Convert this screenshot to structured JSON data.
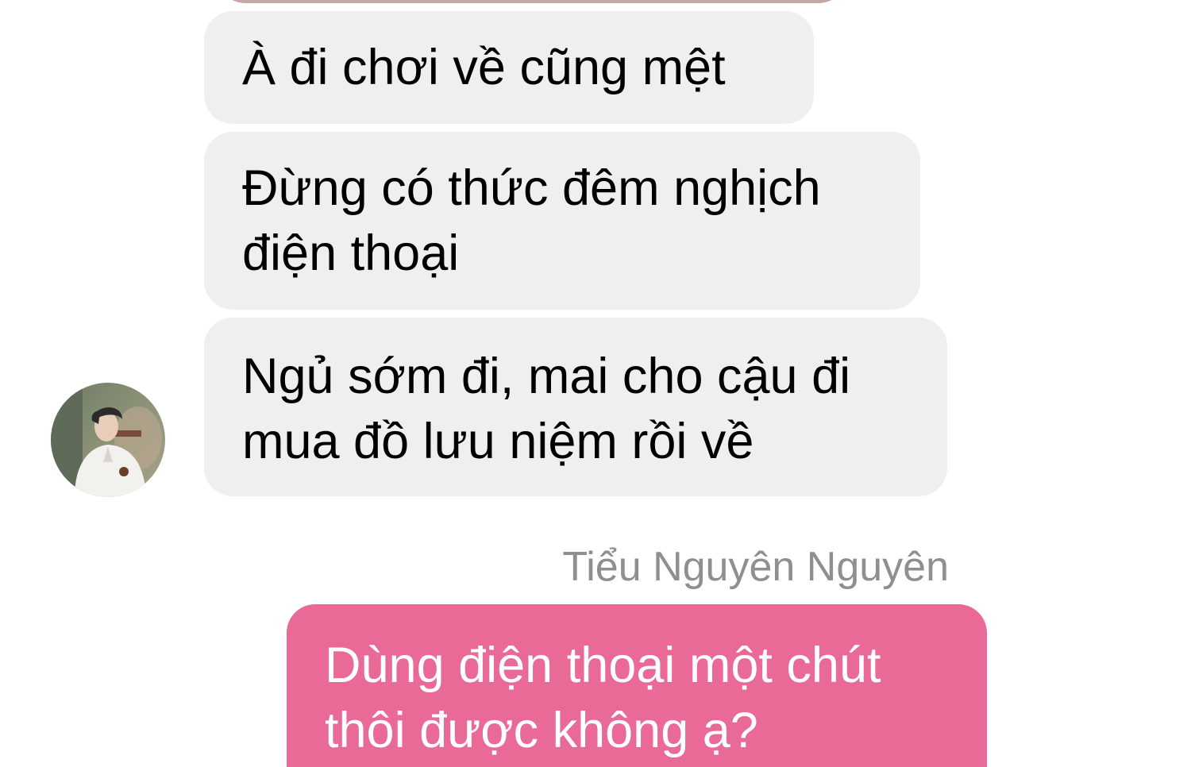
{
  "messages": [
    {
      "direction": "incoming",
      "text": "À đi chơi về cũng mệt"
    },
    {
      "direction": "incoming",
      "text": "Đừng có thức đêm nghịch\nđiện thoại"
    },
    {
      "direction": "incoming",
      "text": "Ngủ sớm đi, mai cho cậu đi\nmua đồ lưu niệm rồi về"
    },
    {
      "direction": "outgoing",
      "text": "Dùng điện thoại một chút\nthôi được không ạ?"
    }
  ],
  "outgoing_sender_name": "Tiểu Nguyên Nguyên",
  "colors": {
    "incoming_bubble": "#efeff1",
    "outgoing_bubble": "#e96a96",
    "sender_name": "#8e8e93",
    "background": "#ffffff"
  }
}
